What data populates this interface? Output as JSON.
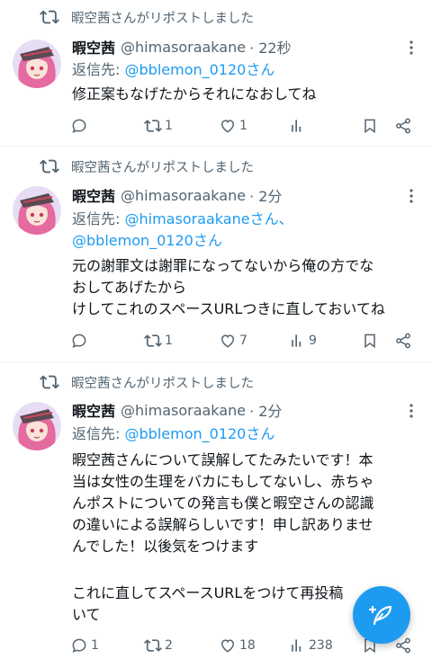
{
  "accent_color": "#1d9bf0",
  "text_secondary_color": "#536471",
  "fab": {
    "icon": "compose-post-icon"
  },
  "tweets": [
    {
      "repost_text": "暇空茜さんがリポストしました",
      "name": "暇空茜",
      "handle": "@himasoraakane",
      "time": "· 22秒",
      "reply_label": "返信先:",
      "reply_lines": [
        {
          "mentions": "@bblemon_0120",
          "suffix": "さん"
        }
      ],
      "body_lines": [
        "修正案もなげたからそれになおしてね"
      ],
      "counts": {
        "reply": "",
        "retweet": "1",
        "like": "1",
        "views": ""
      }
    },
    {
      "repost_text": "暇空茜さんがリポストしました",
      "name": "暇空茜",
      "handle": "@himasoraakane",
      "time": "· 2分",
      "reply_label": "返信先:",
      "reply_lines": [
        {
          "mentions": "@himasoraakane",
          "suffix": "さん、"
        },
        {
          "mentions": "@bblemon_0120",
          "suffix": "さん"
        }
      ],
      "body_lines": [
        "元の謝罪文は謝罪になってないから俺の方でな",
        "おしてあげたから",
        "けしてこれのスペースURLつきに直しておいてね"
      ],
      "counts": {
        "reply": "",
        "retweet": "1",
        "like": "7",
        "views": "9"
      }
    },
    {
      "repost_text": "暇空茜さんがリポストしました",
      "name": "暇空茜",
      "handle": "@himasoraakane",
      "time": "· 2分",
      "reply_label": "返信先:",
      "reply_lines": [
        {
          "mentions": "@bblemon_0120",
          "suffix": "さん"
        }
      ],
      "body_lines": [
        "暇空茜さんについて誤解してたみたいです！本",
        "当は女性の生理をバカにもしてないし、赤ちゃ",
        "んポストについての発言も僕と暇空さんの認識",
        "の違いによる誤解らしいです！申し訳ありませ",
        "んでした！以後気をつけます",
        "",
        "これに直してスペースURLをつけて再投稿",
        "いて"
      ],
      "counts": {
        "reply": "1",
        "retweet": "2",
        "like": "18",
        "views": "238"
      }
    }
  ]
}
